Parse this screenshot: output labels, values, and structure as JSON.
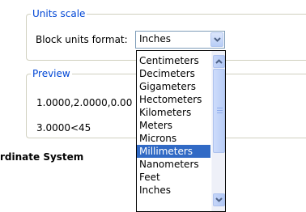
{
  "units_scale": {
    "legend": "Units scale",
    "block_units_label": "Block units format:",
    "block_units_value": "Inches"
  },
  "preview": {
    "legend": "Preview",
    "line1": "1.0000,2.0000,0.00",
    "line2": "3.0000<45"
  },
  "section": {
    "title": "rdinate System"
  },
  "dropdown": {
    "options": [
      "Centimeters",
      "Decimeters",
      "Gigameters",
      "Hectometers",
      "Kilometers",
      "Meters",
      "Microns",
      "Millimeters",
      "Nanometers",
      "Feet",
      "Inches"
    ],
    "selected": "Millimeters"
  },
  "colors": {
    "accent": "#0046d5",
    "selection": "#316ac5"
  },
  "icons": {
    "combo_arrow": "chevron-down-icon",
    "scroll_up": "chevron-up-icon",
    "scroll_down": "chevron-down-icon"
  }
}
